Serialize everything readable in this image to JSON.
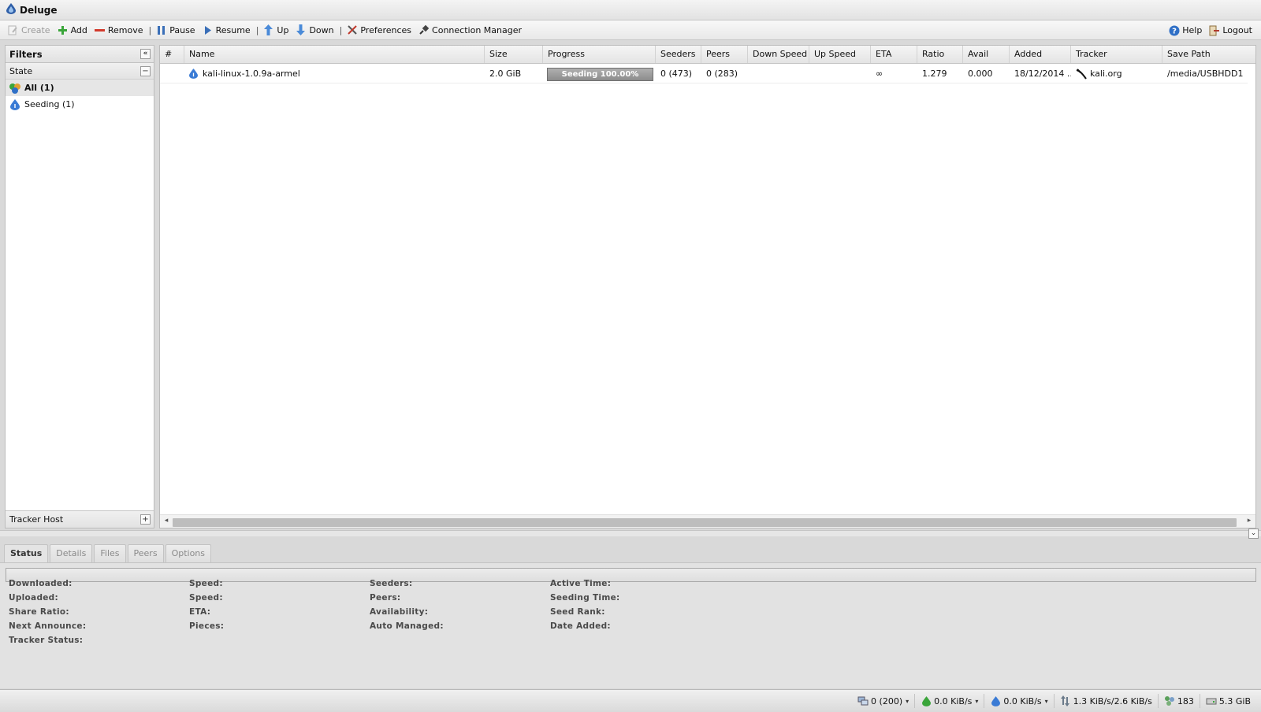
{
  "window": {
    "title": "Deluge"
  },
  "toolbar": {
    "create": "Create",
    "add": "Add",
    "remove": "Remove",
    "pause": "Pause",
    "resume": "Resume",
    "up": "Up",
    "down": "Down",
    "preferences": "Preferences",
    "connection_manager": "Connection Manager",
    "help": "Help",
    "logout": "Logout",
    "separator": "|"
  },
  "sidebar": {
    "title": "Filters",
    "collapse_glyph": "«",
    "state_label": "State",
    "state_toggle": "−",
    "filters": [
      {
        "label": "All (1)",
        "icon": "all-states-icon",
        "selected": true
      },
      {
        "label": "Seeding (1)",
        "icon": "seeding-icon",
        "selected": false
      }
    ],
    "tracker_host_label": "Tracker Host",
    "tracker_toggle": "+"
  },
  "grid": {
    "columns": [
      "#",
      "Name",
      "Size",
      "Progress",
      "Seeders",
      "Peers",
      "Down Speed",
      "Up Speed",
      "ETA",
      "Ratio",
      "Avail",
      "Added",
      "Tracker",
      "Save Path"
    ],
    "rows": [
      {
        "num": "",
        "name": "kali-linux-1.0.9a-armel",
        "size": "2.0 GiB",
        "progress_text": "Seeding 100.00%",
        "progress_value": 1.0,
        "seeders": "0 (473)",
        "peers": "0 (283)",
        "down_speed": "",
        "up_speed": "",
        "eta": "∞",
        "ratio": "1.279",
        "avail": "0.000",
        "added": "18/12/2014 ...",
        "tracker": "kali.org",
        "save_path": "/media/USBHDD1"
      }
    ],
    "scroll_left": "◂",
    "scroll_right": "▸"
  },
  "details": {
    "expand_glyph": "⌄",
    "tabs": [
      {
        "label": "Status",
        "active": true
      },
      {
        "label": "Details",
        "active": false
      },
      {
        "label": "Files",
        "active": false
      },
      {
        "label": "Peers",
        "active": false
      },
      {
        "label": "Options",
        "active": false
      }
    ],
    "col1": [
      "Downloaded:",
      "Uploaded:",
      "Share Ratio:",
      "Next Announce:",
      "Tracker Status:"
    ],
    "col2": [
      "Speed:",
      "Speed:",
      "ETA:",
      "Pieces:"
    ],
    "col3": [
      "Seeders:",
      "Peers:",
      "Availability:",
      "Auto Managed:"
    ],
    "col4": [
      "Active Time:",
      "Seeding Time:",
      "Seed Rank:",
      "Date Added:"
    ]
  },
  "statusbar": {
    "connections": "0 (200)",
    "down_speed": "0.0 KiB/s",
    "up_speed": "0.0 KiB/s",
    "protocol_traffic": "1.3 KiB/s/2.6 KiB/s",
    "dht_nodes": "183",
    "free_space": "5.3 GiB",
    "caret": "▾"
  },
  "colors": {
    "accent_blue": "#2f6fc6",
    "add_green": "#3aa53a",
    "remove_red": "#d33a2c",
    "progress_gray": "#8f8f8f"
  }
}
